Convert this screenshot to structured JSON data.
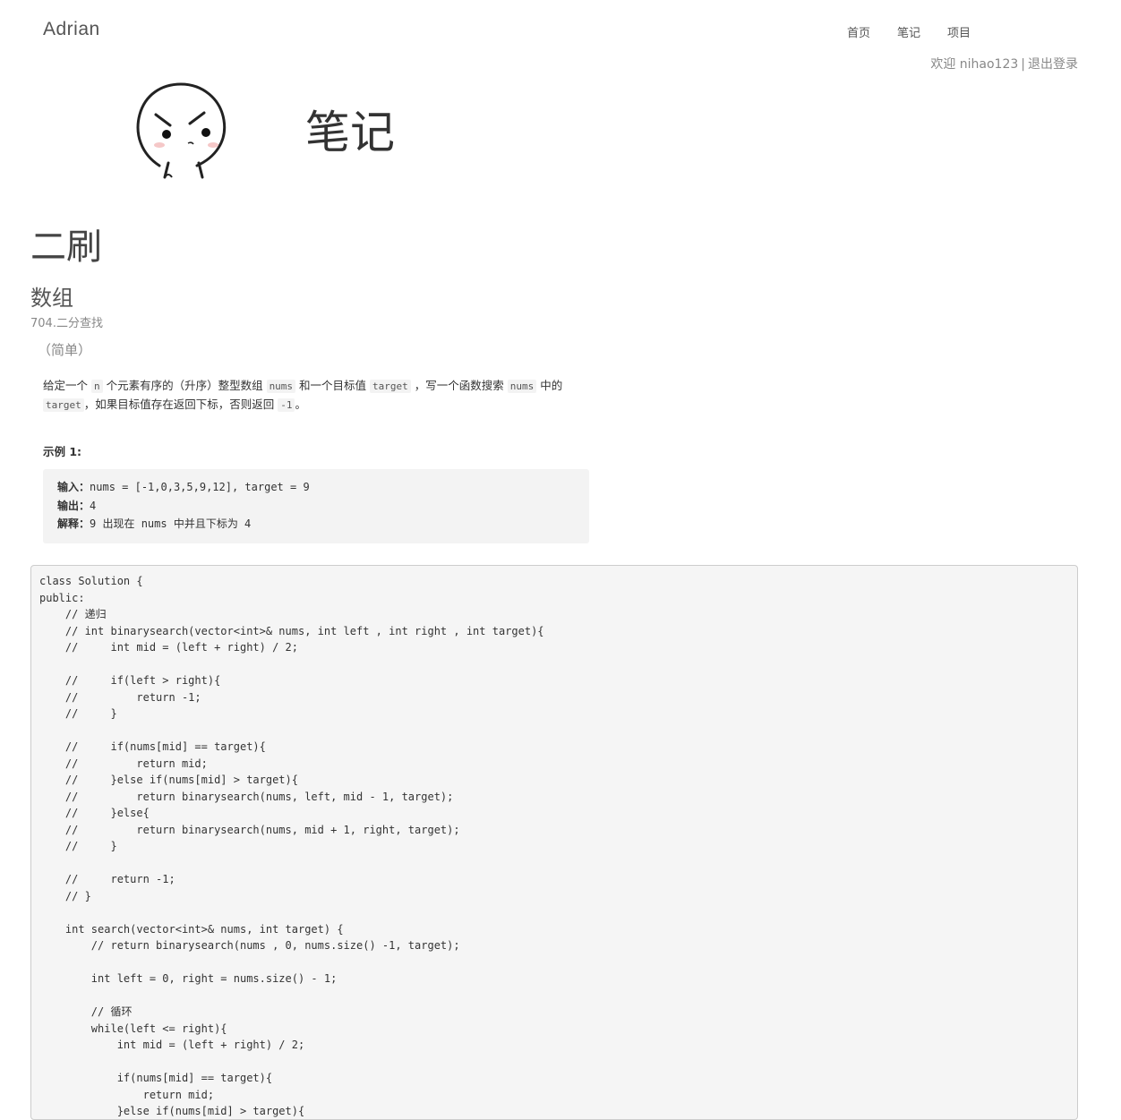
{
  "nav": {
    "brand": "Adrian",
    "links": [
      "首页",
      "笔记",
      "项目"
    ]
  },
  "user": {
    "welcome": "欢迎 nihao123",
    "separator": "|",
    "logout": "退出登录"
  },
  "header": {
    "title": "笔记"
  },
  "content": {
    "h1": "二刷",
    "h2": "数组",
    "problem_link": "704.二分查找",
    "difficulty": "（简单）",
    "desc": {
      "t1": "给定一个 ",
      "c1": "n",
      "t2": " 个元素有序的（升序）整型数组 ",
      "c2": "nums",
      "t3": " 和一个目标值 ",
      "c3": "target",
      "t4": " ，写一个函数搜索 ",
      "c4": "nums",
      "t5": " 中的 ",
      "c5": "target",
      "t6": "，如果目标值存在返回下标，否则返回 ",
      "c6": "-1",
      "t7": "。"
    },
    "example_title": "示例 1:",
    "example": {
      "input_label": "输入",
      "input_value": "nums = [-1,0,3,5,9,12], target = 9",
      "output_label": "输出",
      "output_value": "4",
      "explain_label": "解释",
      "explain_value": "9 出现在 nums 中并且下标为 4"
    },
    "code": "class Solution {\npublic:\n    // 递归\n    // int binarysearch(vector<int>& nums, int left , int right , int target){\n    //     int mid = (left + right) / 2;\n\n    //     if(left > right){\n    //         return -1;\n    //     }\n\n    //     if(nums[mid] == target){\n    //         return mid;\n    //     }else if(nums[mid] > target){\n    //         return binarysearch(nums, left, mid - 1, target);\n    //     }else{\n    //         return binarysearch(nums, mid + 1, right, target);\n    //     }\n\n    //     return -1;\n    // }\n\n    int search(vector<int>& nums, int target) {\n        // return binarysearch(nums , 0, nums.size() -1, target);\n\n        int left = 0, right = nums.size() - 1;\n\n        // 循环\n        while(left <= right){\n            int mid = (left + right) / 2;\n\n            if(nums[mid] == target){\n                return mid;\n            }else if(nums[mid] > target){"
  }
}
